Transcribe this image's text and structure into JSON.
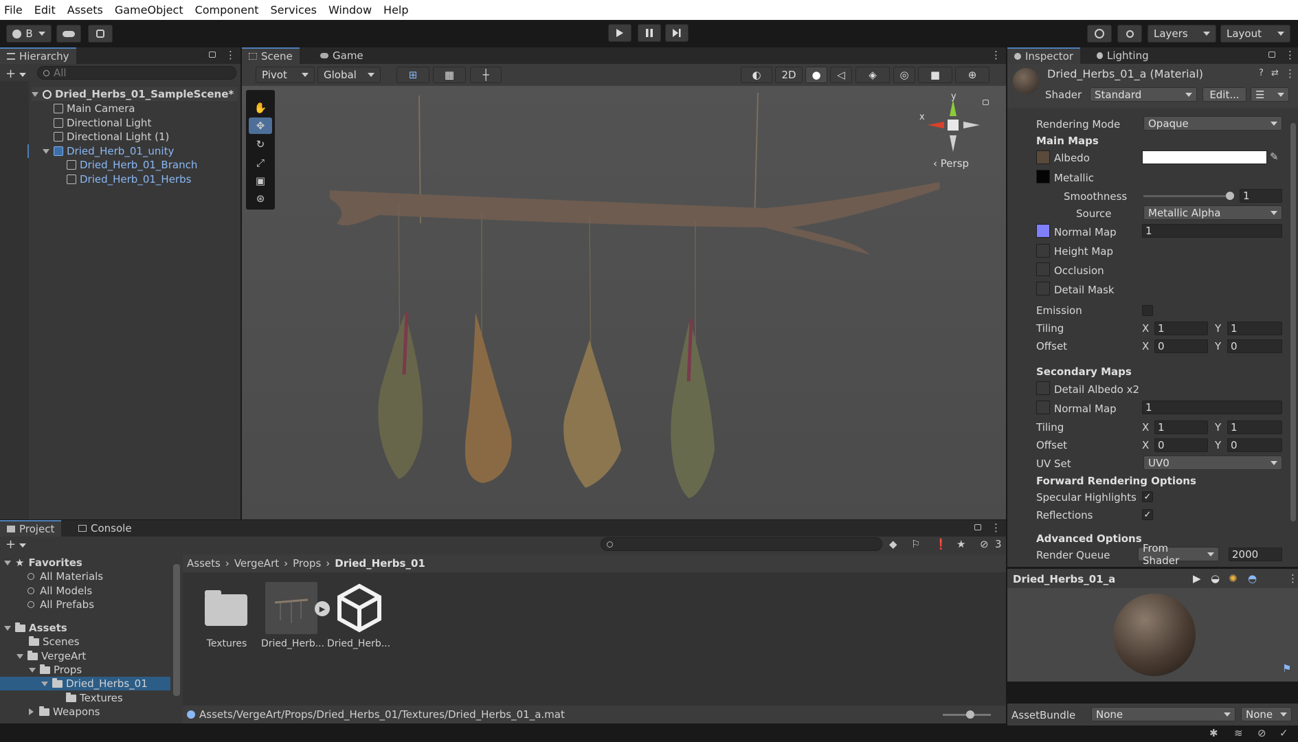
{
  "menu": [
    "File",
    "Edit",
    "Assets",
    "GameObject",
    "Component",
    "Services",
    "Window",
    "Help"
  ],
  "toolbar": {
    "account": "B",
    "layers": "Layers",
    "layout": "Layout"
  },
  "hierarchy": {
    "tab": "Hierarchy",
    "search_placeholder": "All",
    "scene": "Dried_Herbs_01_SampleScene*",
    "items": [
      "Main Camera",
      "Directional Light",
      "Directional Light (1)",
      "Dried_Herb_01_unity",
      "Dried_Herb_01_Branch",
      "Dried_Herb_01_Herbs"
    ]
  },
  "scene": {
    "tab_scene": "Scene",
    "tab_game": "Game",
    "pivot": "Pivot",
    "global": "Global",
    "mode2d": "2D",
    "persp": "Persp",
    "gizmo_x": "x",
    "gizmo_y": "y"
  },
  "inspector": {
    "tab": "Inspector",
    "tab_lighting": "Lighting",
    "material": "Dried_Herbs_01_a (Material)",
    "shader_label": "Shader",
    "shader": "Standard",
    "edit": "Edit...",
    "rendering_mode_label": "Rendering Mode",
    "rendering_mode": "Opaque",
    "main_maps": "Main Maps",
    "albedo": "Albedo",
    "metallic": "Metallic",
    "smoothness": "Smoothness",
    "smoothness_value": "1",
    "source": "Source",
    "source_value": "Metallic Alpha",
    "normal_map": "Normal Map",
    "normal_value": "1",
    "height_map": "Height Map",
    "occlusion": "Occlusion",
    "detail_mask": "Detail Mask",
    "emission": "Emission",
    "tiling": "Tiling",
    "offset": "Offset",
    "x": "X",
    "y": "Y",
    "tiling_x": "1",
    "tiling_y": "1",
    "offset_x": "0",
    "offset_y": "0",
    "secondary_maps": "Secondary Maps",
    "detail_albedo": "Detail Albedo x2",
    "normal_map2": "Normal Map",
    "normal2_value": "1",
    "tiling2_x": "1",
    "tiling2_y": "1",
    "offset2_x": "0",
    "offset2_y": "0",
    "uv_set": "UV Set",
    "uv_value": "UV0",
    "forward": "Forward Rendering Options",
    "specular": "Specular Highlights",
    "reflections": "Reflections",
    "advanced": "Advanced Options",
    "render_queue": "Render Queue",
    "render_queue_mode": "From Shader",
    "render_queue_value": "2000",
    "preview_name": "Dried_Herbs_01_a",
    "assetbundle": "AssetBundle",
    "assetbundle_value": "None",
    "assetbundle_variant": "None"
  },
  "project": {
    "tab": "Project",
    "tab_console": "Console",
    "hidden_count": "3",
    "favorites": "Favorites",
    "fav_items": [
      "All Materials",
      "All Models",
      "All Prefabs"
    ],
    "assets": "Assets",
    "tree": [
      "Scenes",
      "VergeArt",
      "Props",
      "Dried_Herbs_01",
      "Textures",
      "Weapons"
    ],
    "breadcrumb": [
      "Assets",
      "VergeArt",
      "Props",
      "Dried_Herbs_01"
    ],
    "files": [
      "Textures",
      "Dried_Herb...",
      "Dried_Herb..."
    ],
    "path": "Assets/VergeArt/Props/Dried_Herbs_01/Textures/Dried_Herbs_01_a.mat"
  },
  "colors": {
    "accent": "#4d7eb8",
    "selected": "#2c5d87",
    "normal_swatch": "#8080ff"
  }
}
